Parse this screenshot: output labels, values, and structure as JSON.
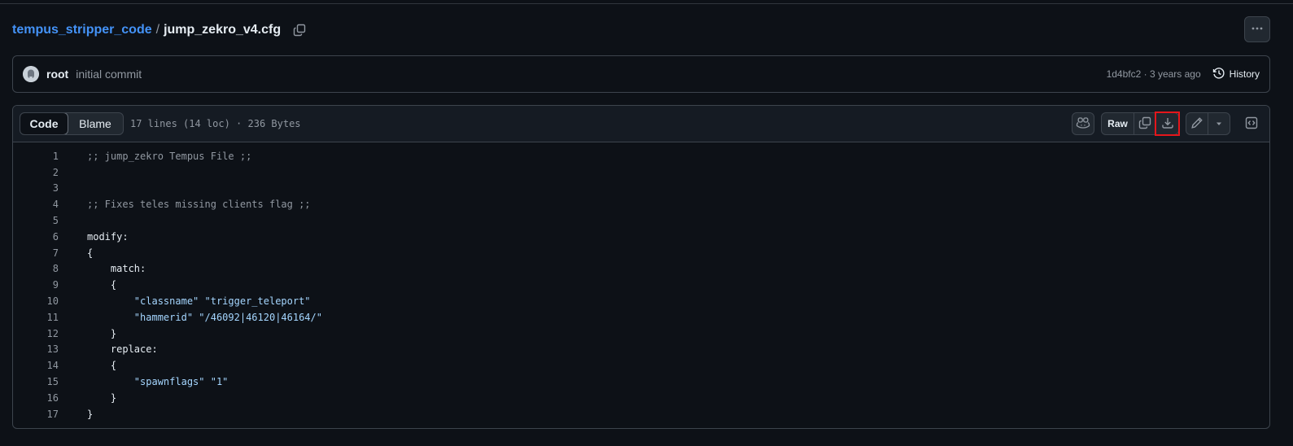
{
  "breadcrumb": {
    "repo": "tempus_stripper_code",
    "separator": "/",
    "file": "jump_zekro_v4.cfg"
  },
  "commit": {
    "author": "root",
    "message": "initial commit",
    "sha_time": "1d4bfc2 · 3 years ago",
    "history_label": "History"
  },
  "file_header": {
    "tabs": [
      "Code",
      "Blame"
    ],
    "active_tab": "Code",
    "meta": "17 lines (14 loc) · 236 Bytes",
    "raw_label": "Raw"
  },
  "code_lines": [
    {
      "n": "1",
      "text": ";; jump_zekro Tempus File ;;",
      "kind": "comment"
    },
    {
      "n": "2",
      "text": "",
      "kind": "plain"
    },
    {
      "n": "3",
      "text": "",
      "kind": "plain"
    },
    {
      "n": "4",
      "text": ";; Fixes teles missing clients flag ;;",
      "kind": "comment"
    },
    {
      "n": "5",
      "text": "",
      "kind": "plain"
    },
    {
      "n": "6",
      "text": "modify:",
      "kind": "plain"
    },
    {
      "n": "7",
      "text": "{",
      "kind": "plain"
    },
    {
      "n": "8",
      "text": "    match:",
      "kind": "plain"
    },
    {
      "n": "9",
      "text": "    {",
      "kind": "plain"
    },
    {
      "n": "10",
      "text": "        \"classname\" \"trigger_teleport\"",
      "kind": "string"
    },
    {
      "n": "11",
      "text": "        \"hammerid\" \"/46092|46120|46164/\"",
      "kind": "string"
    },
    {
      "n": "12",
      "text": "    }",
      "kind": "plain"
    },
    {
      "n": "13",
      "text": "    replace:",
      "kind": "plain"
    },
    {
      "n": "14",
      "text": "    {",
      "kind": "plain"
    },
    {
      "n": "15",
      "text": "        \"spawnflags\" \"1\"",
      "kind": "string"
    },
    {
      "n": "16",
      "text": "    }",
      "kind": "plain"
    },
    {
      "n": "17",
      "text": "}",
      "kind": "plain"
    }
  ],
  "icons": {
    "copy_path": "copy-icon",
    "more": "kebab-horizontal-icon",
    "history": "history-icon",
    "copilot": "copilot-icon",
    "copy_raw": "copy-icon",
    "download": "download-icon",
    "edit": "pencil-icon",
    "edit_dropdown": "triangle-down-icon",
    "symbols": "code-square-icon"
  },
  "colors": {
    "link": "#4493f8",
    "highlight_outline": "#e5161b"
  }
}
